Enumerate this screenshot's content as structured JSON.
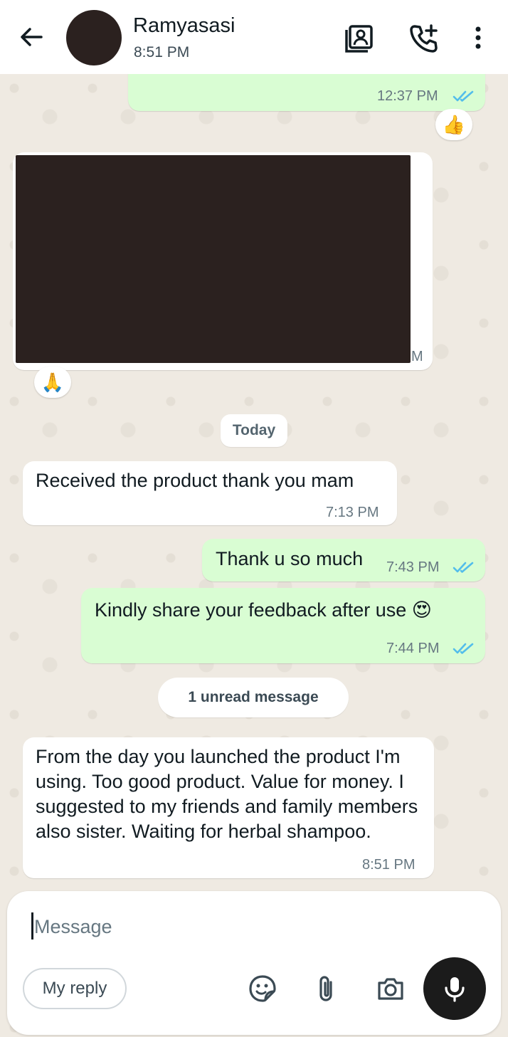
{
  "header": {
    "contact_name": "Ramyasasi",
    "status": "8:51 PM",
    "icons": [
      "back-arrow-icon",
      "avatar",
      "contact-card-icon",
      "add-call-icon",
      "more-vert-icon"
    ]
  },
  "messages": {
    "prev_out_time": "12:37 PM",
    "prev_out_reaction": "👍",
    "image_time_fragment": "M",
    "image_reaction": "🙏",
    "date_divider": "Today",
    "m1_text": "Received the product thank you mam",
    "m1_time": "7:13 PM",
    "m2_text": "Thank u so much",
    "m2_time": "7:43 PM",
    "m3_text": "Kindly share your feedback after use 😍",
    "m3_time": "7:44 PM",
    "unread_divider": "1 unread message",
    "m4_text": "From the day you launched the product I'm using. Too good product. Value for money. I suggested to my friends and family members also sister. Waiting for herbal shampoo.",
    "m4_time": "8:51 PM"
  },
  "composer": {
    "placeholder": "Message",
    "chip_label": "My reply",
    "icons": [
      "sticker-icon",
      "attach-icon",
      "camera-icon",
      "mic-icon"
    ]
  },
  "colors": {
    "outgoing_bubble": "#d9fdd3",
    "incoming_bubble": "#ffffff",
    "chat_background": "#efeae2",
    "read_ticks": "#53bdeb"
  }
}
